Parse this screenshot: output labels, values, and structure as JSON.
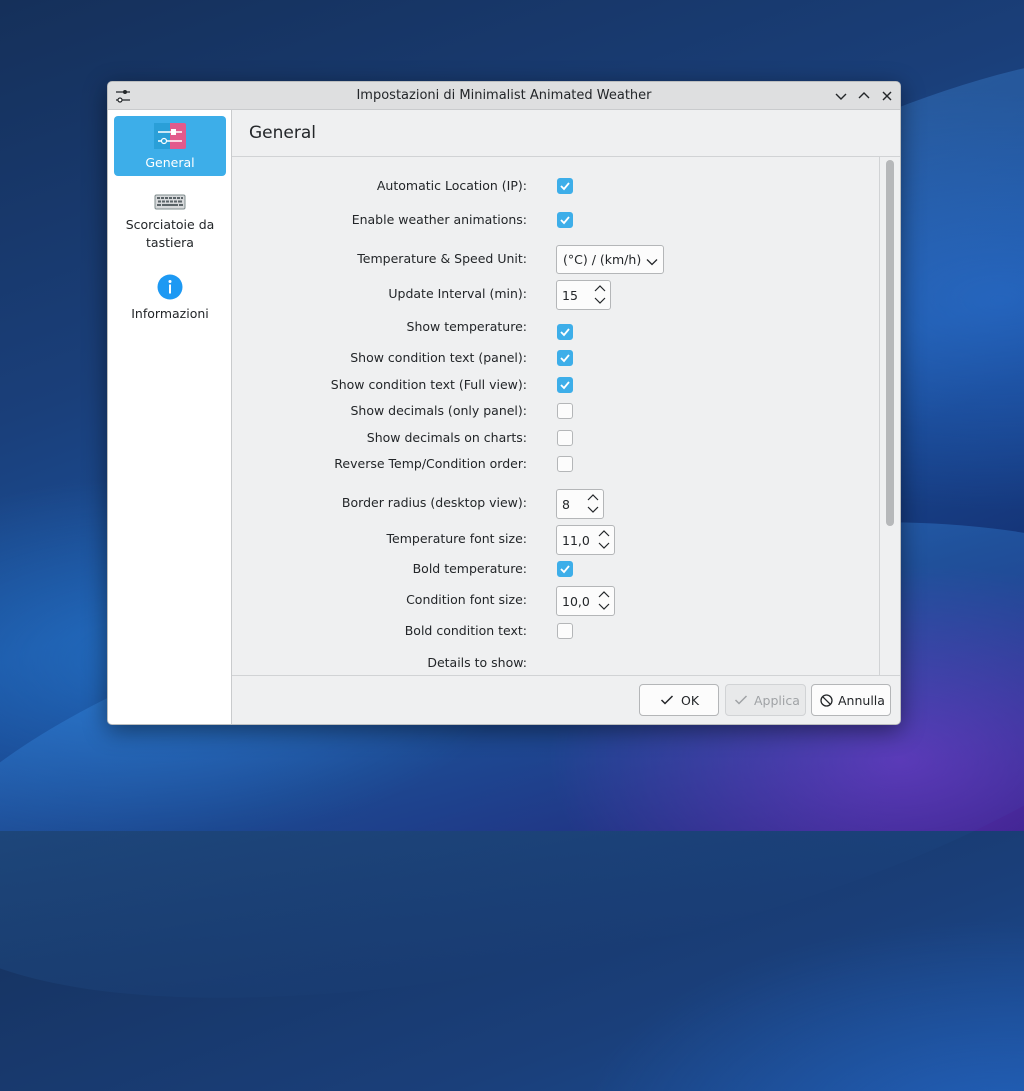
{
  "window": {
    "title": "Impostazioni di Minimalist Animated Weather",
    "controls": [
      "minimize-icon",
      "maximize-icon",
      "close-icon"
    ]
  },
  "sidebar": {
    "items": [
      {
        "label": "General",
        "icon": "settings-sliders-icon",
        "active": true
      },
      {
        "label": "Scorciatoie da tastiera",
        "icon": "keyboard-icon",
        "active": false
      },
      {
        "label": "Informazioni",
        "icon": "info-icon",
        "active": false
      }
    ]
  },
  "page": {
    "title": "General"
  },
  "form": {
    "automatic_location": {
      "label": "Automatic Location (IP):",
      "checked": true
    },
    "weather_animations": {
      "label": "Enable weather animations:",
      "checked": true
    },
    "temp_speed_unit": {
      "label": "Temperature & Speed Unit:",
      "value": "(°C) / (km/h)"
    },
    "update_interval": {
      "label": "Update Interval (min):",
      "value": "15"
    },
    "show_temperature": {
      "label": "Show temperature:",
      "checked": true
    },
    "show_condition_panel": {
      "label": "Show condition text (panel):",
      "checked": true
    },
    "show_condition_full": {
      "label": "Show condition text (Full view):",
      "checked": true
    },
    "show_decimals_panel": {
      "label": "Show decimals (only panel):",
      "checked": false
    },
    "show_decimals_charts": {
      "label": "Show decimals on charts:",
      "checked": false
    },
    "reverse_order": {
      "label": "Reverse Temp/Condition order:",
      "checked": false
    },
    "border_radius": {
      "label": "Border radius (desktop view):",
      "value": "8"
    },
    "temp_font_size": {
      "label": "Temperature font size:",
      "value": "11,0"
    },
    "bold_temperature": {
      "label": "Bold temperature:",
      "checked": true
    },
    "condition_font_size": {
      "label": "Condition font size:",
      "value": "10,0"
    },
    "bold_condition": {
      "label": "Bold condition text:",
      "checked": false
    },
    "details_to_show": {
      "label": "Details to show:"
    }
  },
  "footer": {
    "ok_label": "OK",
    "apply_label": "Applica",
    "cancel_label": "Annulla"
  },
  "colors": {
    "accent": "#3daee9",
    "window_bg": "#eff0f1"
  }
}
